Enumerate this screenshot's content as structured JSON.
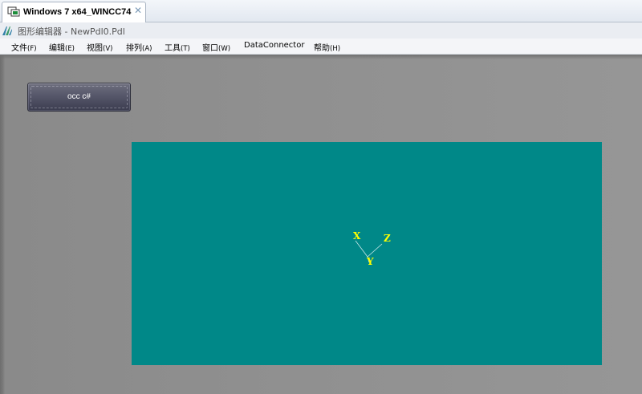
{
  "vm_tab": {
    "label": "Windows 7 x64_WINCC74",
    "close_glyph": "✕",
    "icon": "vm-monitor-icon"
  },
  "editor": {
    "title": "图形编辑器 - NewPdl0.Pdl",
    "icon": "graphics-designer-icon"
  },
  "menu": [
    {
      "text": "文件",
      "accel": "(F)"
    },
    {
      "text": "编辑",
      "accel": "(E)"
    },
    {
      "text": "视图",
      "accel": "(V)"
    },
    {
      "text": "排列",
      "accel": "(A)"
    },
    {
      "text": "工具",
      "accel": "(T)"
    },
    {
      "text": "窗口",
      "accel": "(W)"
    },
    {
      "text": "DataConnector",
      "accel": ""
    },
    {
      "text": "帮助",
      "accel": "(H)"
    }
  ],
  "canvas": {
    "button_label": "occ c#",
    "view_color": "#008888",
    "axes": {
      "x": "X",
      "y": "Y",
      "z": "Z"
    },
    "axis_label_color": "#ffff00",
    "background_color": "#8f8f8f"
  }
}
